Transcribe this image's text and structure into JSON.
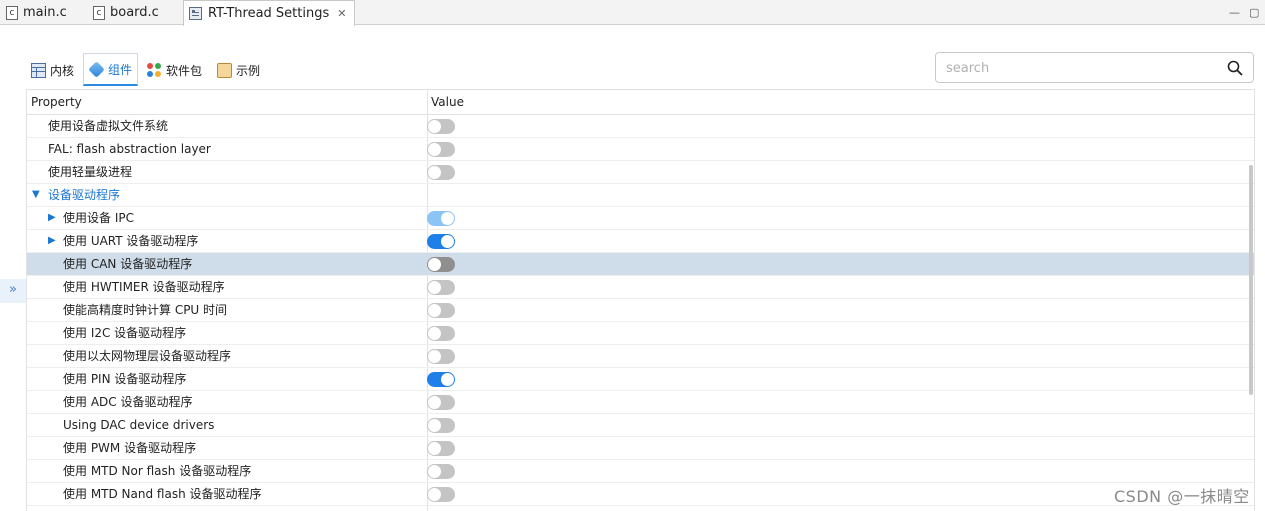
{
  "editor_tabs": [
    {
      "label": "main.c",
      "icon": "c-file-icon"
    },
    {
      "label": "board.c",
      "icon": "c-file-icon"
    },
    {
      "label": "RT-Thread Settings",
      "icon": "settings-file-icon",
      "close": "✕"
    }
  ],
  "window_controls": {
    "minimize": "—",
    "restore": "▢"
  },
  "categories": [
    "内核",
    "组件",
    "软件包",
    "示例"
  ],
  "active_category": "组件",
  "search": {
    "placeholder": "search",
    "value": ""
  },
  "side_toggle": "»",
  "table": {
    "header": {
      "property": "Property",
      "value": "Value"
    },
    "rows": [
      {
        "label": "使用设备虚拟文件系统",
        "state": "off"
      },
      {
        "label": "FAL: flash abstraction layer",
        "state": "off"
      },
      {
        "label": "使用轻量级进程",
        "state": "off"
      },
      {
        "label": "设备驱动程序",
        "group": true,
        "expanded": true,
        "arrow": "▼"
      },
      {
        "label": "使用设备 IPC",
        "state": "partial",
        "arrow": "▶"
      },
      {
        "label": "使用 UART 设备驱动程序",
        "state": "on",
        "arrow": "▶"
      },
      {
        "label": "使用 CAN 设备驱动程序",
        "state": "off",
        "selected": true
      },
      {
        "label": "使用 HWTIMER 设备驱动程序",
        "state": "off"
      },
      {
        "label": "使能高精度时钟计算 CPU 时间",
        "state": "off"
      },
      {
        "label": "使用 I2C 设备驱动程序",
        "state": "off"
      },
      {
        "label": "使用以太网物理层设备驱动程序",
        "state": "off"
      },
      {
        "label": "使用 PIN 设备驱动程序",
        "state": "on"
      },
      {
        "label": "使用 ADC 设备驱动程序",
        "state": "off"
      },
      {
        "label": "Using DAC device drivers",
        "state": "off"
      },
      {
        "label": "使用 PWM 设备驱动程序",
        "state": "off"
      },
      {
        "label": "使用 MTD Nor flash 设备驱动程序",
        "state": "off"
      },
      {
        "label": "使用 MTD Nand flash 设备驱动程序",
        "state": "off"
      }
    ]
  },
  "watermark": "CSDN @一抹晴空",
  "colors": {
    "accent": "#1c77d2",
    "toggle_on": "#1e7fe8",
    "toggle_off": "#c4c4c4",
    "selected_row": "#cfdcea"
  }
}
